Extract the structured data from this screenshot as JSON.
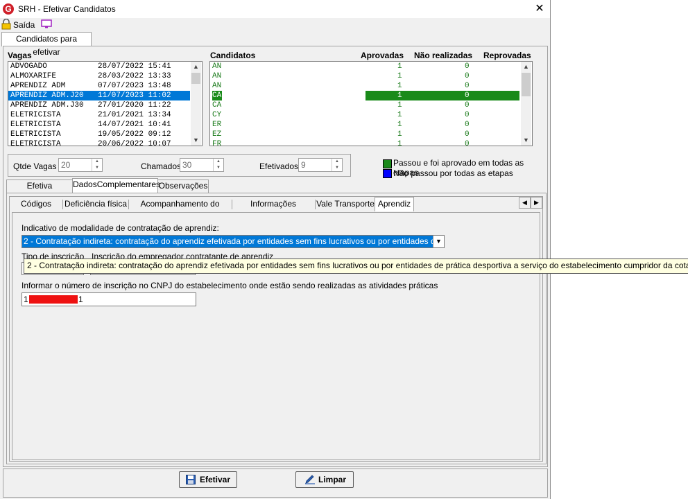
{
  "window": {
    "title": "SRH - Efetivar Candidatos",
    "close_glyph": "✕",
    "app_icon_letter": "G"
  },
  "toolbar": {
    "exit_label": "Saída"
  },
  "main_tab": {
    "label": "Candidatos para efetivar"
  },
  "vagas": {
    "header": "Vagas",
    "items": [
      {
        "name": "ADVOGADO",
        "date": "28/07/2022 15:41"
      },
      {
        "name": "ALMOXARIFE",
        "date": "28/03/2022 13:33"
      },
      {
        "name": "APRENDIZ ADM",
        "date": "07/07/2023 13:48"
      },
      {
        "name": "APRENDIZ ADM.J20",
        "date": "11/07/2023 11:02"
      },
      {
        "name": "APRENDIZ ADM.J30",
        "date": "27/01/2020 11:22"
      },
      {
        "name": "ELETRICISTA",
        "date": "21/01/2021 13:34"
      },
      {
        "name": "ELETRICISTA",
        "date": "14/07/2021 10:41"
      },
      {
        "name": "ELETRICISTA",
        "date": "19/05/2022 09:12"
      },
      {
        "name": "ELETRICISTA",
        "date": "20/06/2022 10:07"
      }
    ],
    "selected_index": 3
  },
  "candidatos": {
    "header": "Candidatos",
    "col_aprovadas": "Aprovadas",
    "col_nao_realizadas": "Não realizadas",
    "col_reprovadas": "Reprovadas",
    "items": [
      {
        "name": "AN",
        "aprovadas": "1",
        "nao_realizadas": "0"
      },
      {
        "name": "AN",
        "aprovadas": "1",
        "nao_realizadas": "0"
      },
      {
        "name": "AN",
        "aprovadas": "1",
        "nao_realizadas": "0"
      },
      {
        "name": "CA",
        "aprovadas": "1",
        "nao_realizadas": "0"
      },
      {
        "name": "CA",
        "aprovadas": "1",
        "nao_realizadas": "0"
      },
      {
        "name": "CY",
        "aprovadas": "1",
        "nao_realizadas": "0"
      },
      {
        "name": "ER",
        "aprovadas": "1",
        "nao_realizadas": "0"
      },
      {
        "name": "EZ",
        "aprovadas": "1",
        "nao_realizadas": "0"
      },
      {
        "name": "FR",
        "aprovadas": "1",
        "nao_realizadas": "0"
      }
    ],
    "selected_index": 3
  },
  "stats": {
    "qtde_vagas_label": "Qtde Vagas",
    "qtde_vagas_value": "20",
    "chamados_label": "Chamados",
    "chamados_value": "30",
    "efetivados_label": "Efetivados",
    "efetivados_value": "9"
  },
  "legend": {
    "passed_label": "Passou e foi aprovado em todas as etapas",
    "not_passed_label": "Não passou por todas as etapas",
    "passed_color": "#00a000",
    "not_passed_color": "#0000ff"
  },
  "tabs": [
    "Efetiva Candidato",
    "DadosComplementares",
    "Observações"
  ],
  "subtabs": [
    "Códigos Fixos",
    "Deficiência física",
    "Acompanhamento do Comitê",
    "Informações Adicionais",
    "Vale Transporte",
    "Aprendiz"
  ],
  "aprendiz": {
    "modalidade_label": "Indicativo de modalidade de contratação de aprendiz:",
    "modalidade_value": "2 - Contratação indireta: contratação do aprendiz efetivada por entidades sem fins lucrativos ou por entidades de prática desportiva a serviço do estabelecimento cumpridor da cota",
    "tipo_inscricao_label": "Tipo de inscrição",
    "inscricao_empregador_label": "Inscrição do empregador contratante de aprendiz",
    "cnpj_label": "Informar o número de inscrição no CNPJ do estabelecimento onde estão sendo realizadas as atividades práticas",
    "cnpj_prefix": "1",
    "cnpj_suffix": "1"
  },
  "tooltip": {
    "text": "2 - Contratação indireta: contratação do aprendiz efetivada por entidades sem fins lucrativos ou por entidades de prática desportiva a serviço do estabelecimento cumpridor da cota"
  },
  "buttons": {
    "efetivar_label": "Efetivar",
    "limpar_label": "Limpar"
  }
}
